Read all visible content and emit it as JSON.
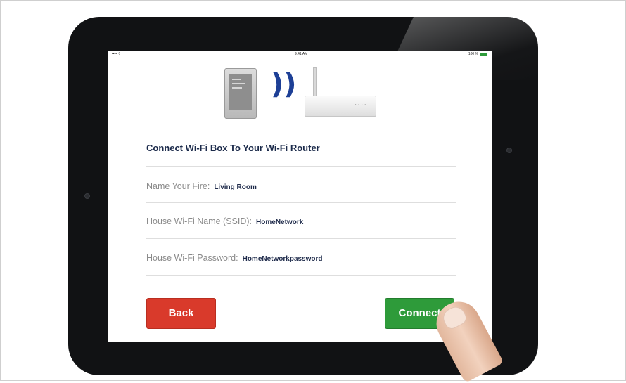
{
  "status_bar": {
    "carrier": "•••• ⌔",
    "time": "9:41 AM",
    "battery": "100 %"
  },
  "screen": {
    "title": "Connect Wi-Fi Box To Your Wi-Fi Router",
    "fields": [
      {
        "label": "Name Your Fire:",
        "value": "Living Room"
      },
      {
        "label": "House Wi-Fi Name (SSID):",
        "value": "HomeNetwork"
      },
      {
        "label": "House Wi-Fi Password:",
        "value": "HomeNetworkpassword"
      }
    ],
    "back_label": "Back",
    "connect_label": "Connect",
    "wifi_glyph": "))",
    "colors": {
      "back": "#d93a2b",
      "connect": "#2e9b3a",
      "wifi": "#1d3f96"
    }
  }
}
